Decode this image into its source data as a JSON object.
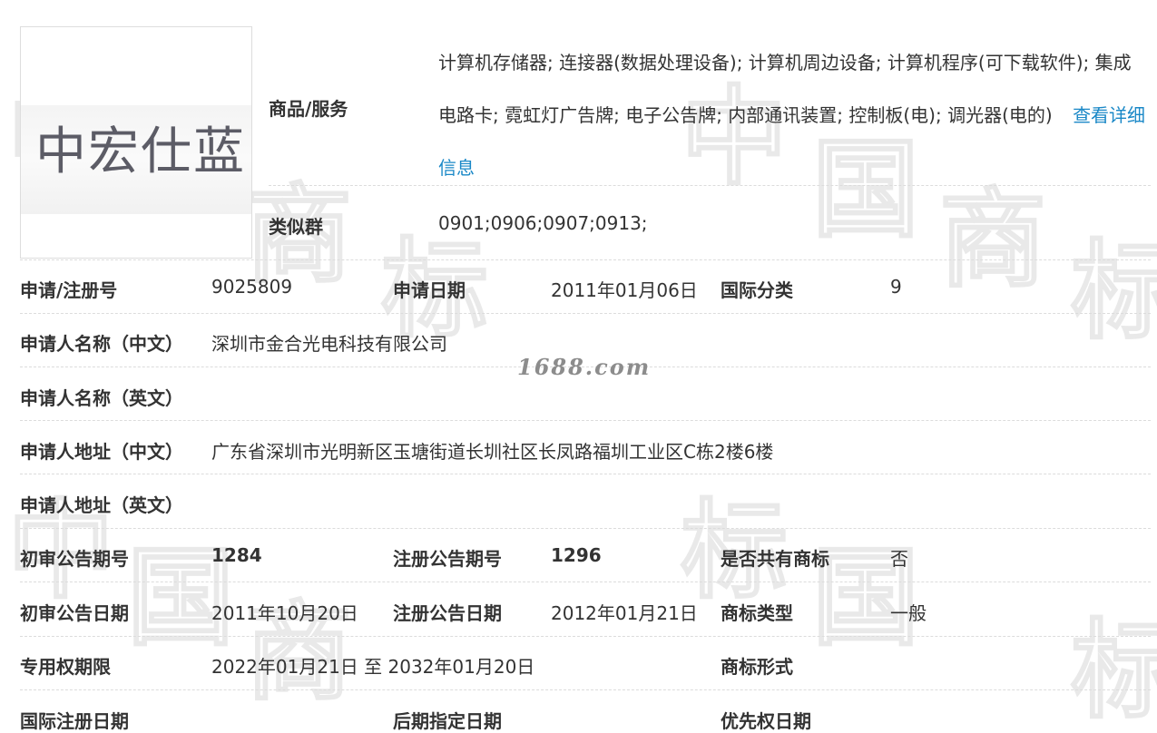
{
  "watermark": {
    "chars": [
      "中",
      "国",
      "商",
      "标",
      "中",
      "国",
      "商",
      "标",
      "中",
      "国",
      "商",
      "标",
      "国",
      "标"
    ],
    "site": "1688.com"
  },
  "logo": {
    "text": "中宏仕蓝"
  },
  "goods": {
    "label": "商品/服务",
    "text": "计算机存储器; 连接器(数据处理设备); 计算机周边设备; 计算机程序(可下载软件); 集成电路卡; 霓虹灯广告牌; 电子公告牌; 内部通讯装置; 控制板(电); 调光器(电的)",
    "link": "查看详细信息"
  },
  "similar_group": {
    "label": "类似群",
    "value": "0901;0906;0907;0913;"
  },
  "rows": [
    {
      "cells": [
        {
          "label": "申请/注册号",
          "value": "9025809"
        },
        {
          "label": "申请日期",
          "value": "2011年01月06日"
        },
        {
          "label": "国际分类",
          "value": "9"
        }
      ]
    },
    {
      "cells": [
        {
          "label": "申请人名称（中文）",
          "value": "深圳市金合光电科技有限公司"
        }
      ]
    },
    {
      "cells": [
        {
          "label": "申请人名称（英文）",
          "value": ""
        }
      ]
    },
    {
      "cells": [
        {
          "label": "申请人地址（中文）",
          "value": "广东省深圳市光明新区玉塘街道长圳社区长凤路福圳工业区C栋2楼6楼"
        }
      ]
    },
    {
      "cells": [
        {
          "label": "申请人地址（英文）",
          "value": ""
        }
      ]
    },
    {
      "cells": [
        {
          "label": "初审公告期号",
          "value": "1284",
          "bold": true
        },
        {
          "label": "注册公告期号",
          "value": "1296",
          "bold": true
        },
        {
          "label": "是否共有商标",
          "value": "否"
        }
      ]
    },
    {
      "cells": [
        {
          "label": "初审公告日期",
          "value": "2011年10月20日"
        },
        {
          "label": "注册公告日期",
          "value": "2012年01月21日"
        },
        {
          "label": "商标类型",
          "value": "一般"
        }
      ]
    },
    {
      "cells": [
        {
          "label": "专用权期限",
          "value": "2022年01月21日 至 2032年01月20日"
        },
        {
          "label": "",
          "value": ""
        },
        {
          "label": "商标形式",
          "value": ""
        }
      ]
    },
    {
      "cells": [
        {
          "label": "国际注册日期",
          "value": ""
        },
        {
          "label": "后期指定日期",
          "value": ""
        },
        {
          "label": "优先权日期",
          "value": ""
        }
      ]
    }
  ]
}
